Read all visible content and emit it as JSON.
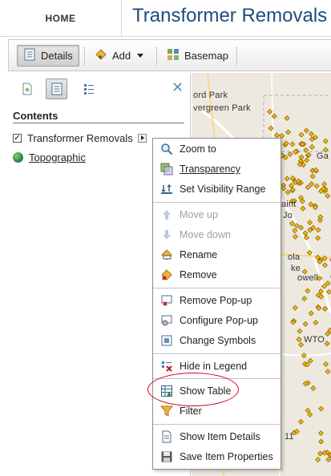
{
  "header": {
    "home_label": "HOME",
    "app_title": "Transformer Removals"
  },
  "toolbar": {
    "details_label": "Details",
    "add_label": "Add",
    "basemap_label": "Basemap"
  },
  "left_pane": {
    "contents_title": "Contents",
    "layers": [
      {
        "label": "Transformer Removals",
        "checked": true
      },
      {
        "label": "Topographic"
      }
    ]
  },
  "map": {
    "labels": [
      "ord Park",
      "vergreen Park",
      "Ga",
      "aint",
      "Jo",
      "ola",
      "ke",
      "owell",
      "WTO",
      "11"
    ]
  },
  "context_menu": {
    "items": [
      {
        "label": "Zoom to",
        "icon": "zoom-icon",
        "enabled": true
      },
      {
        "label": "Transparency",
        "icon": "transparency-icon",
        "enabled": true
      },
      {
        "label": "Set Visibility Range",
        "icon": "visibility-range-icon",
        "enabled": true
      },
      {
        "label": "Move up",
        "icon": "arrow-up-icon",
        "enabled": false
      },
      {
        "label": "Move down",
        "icon": "arrow-down-icon",
        "enabled": false
      },
      {
        "label": "Rename",
        "icon": "rename-icon",
        "enabled": true
      },
      {
        "label": "Remove",
        "icon": "remove-icon",
        "enabled": true
      },
      {
        "label": "Remove Pop-up",
        "icon": "remove-popup-icon",
        "enabled": true
      },
      {
        "label": "Configure Pop-up",
        "icon": "configure-popup-icon",
        "enabled": true
      },
      {
        "label": "Change Symbols",
        "icon": "change-symbols-icon",
        "enabled": true
      },
      {
        "label": "Hide in Legend",
        "icon": "hide-legend-icon",
        "enabled": true
      },
      {
        "label": "Show Table",
        "icon": "table-icon",
        "enabled": true
      },
      {
        "label": "Filter",
        "icon": "filter-icon",
        "enabled": true
      },
      {
        "label": "Show Item Details",
        "icon": "item-details-icon",
        "enabled": true
      },
      {
        "label": "Save Item Properties",
        "icon": "save-icon",
        "enabled": true
      }
    ]
  },
  "colors": {
    "title": "#1f4e79",
    "highlight_ring": "#d9001b",
    "map_points": "#f5b800",
    "close_icon": "#5d8fb5"
  }
}
